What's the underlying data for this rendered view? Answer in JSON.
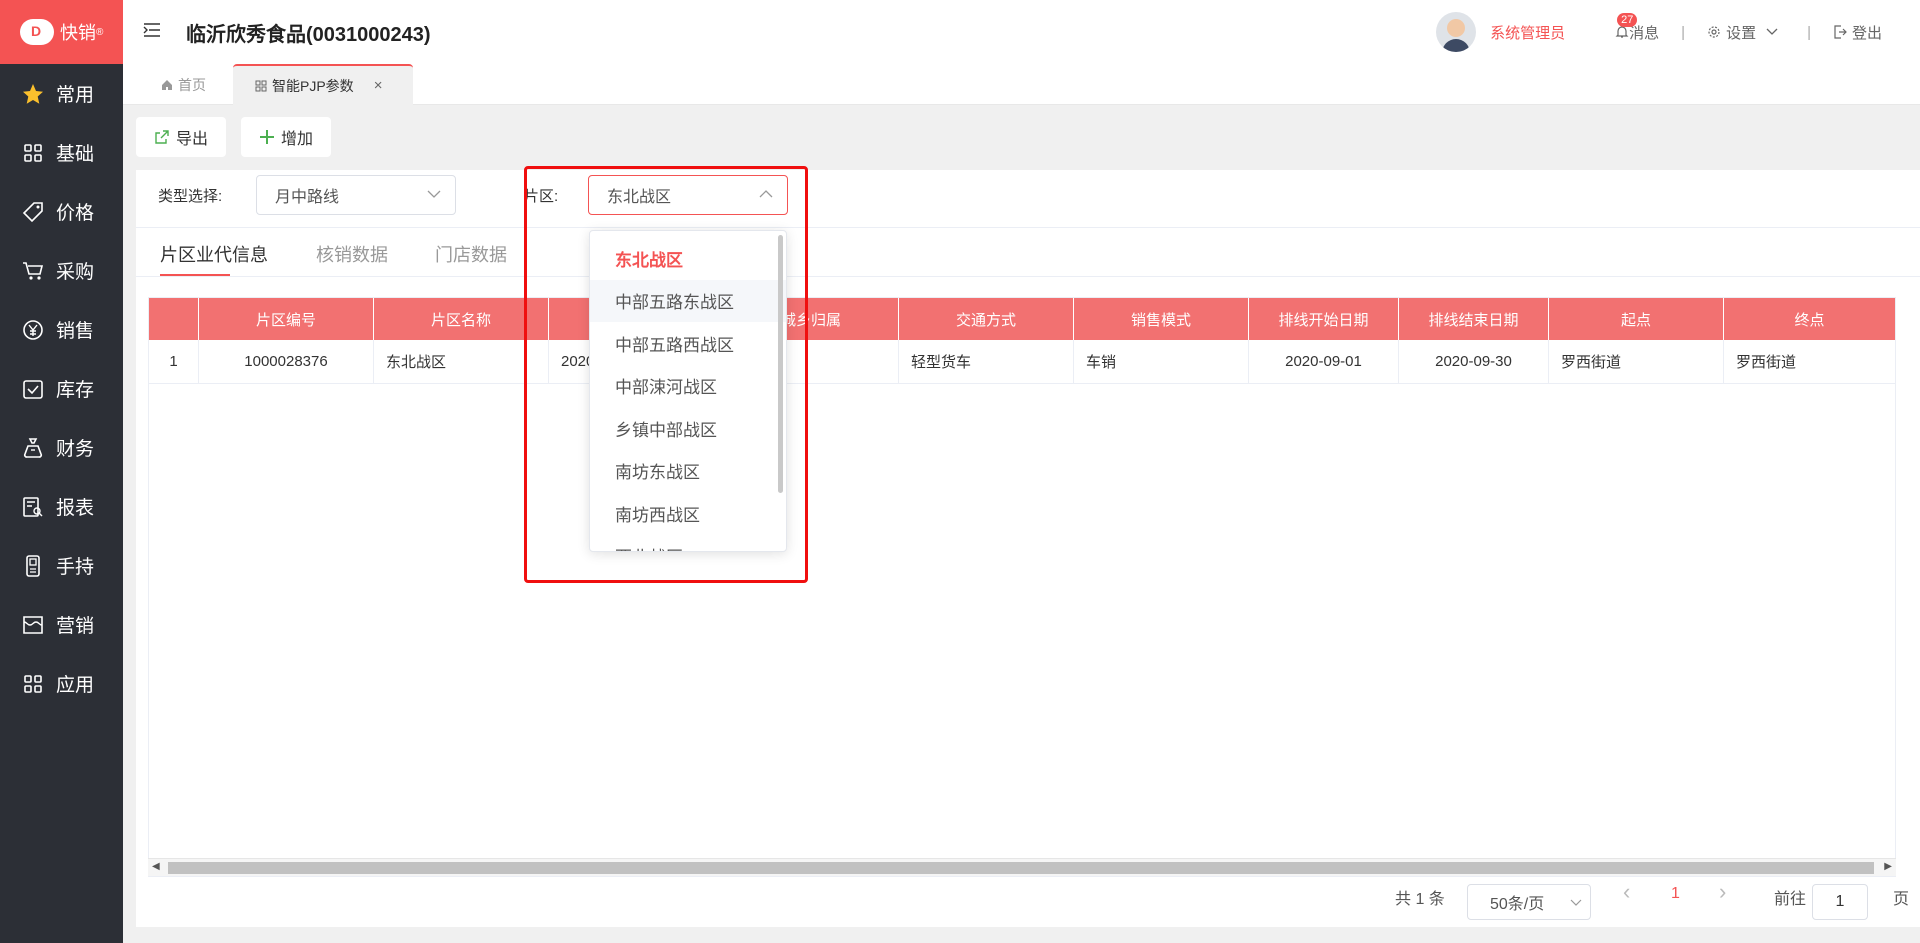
{
  "app": {
    "logo_text": "快销",
    "logo_mark": "®",
    "company": "临沂欣秀食品(0031000243)"
  },
  "sidebar": {
    "items": [
      {
        "label": "常用",
        "icon": "star-icon"
      },
      {
        "label": "基础",
        "icon": "grid-icon"
      },
      {
        "label": "价格",
        "icon": "price-tag-icon"
      },
      {
        "label": "采购",
        "icon": "cart-icon"
      },
      {
        "label": "销售",
        "icon": "yen-icon"
      },
      {
        "label": "库存",
        "icon": "inventory-check-icon"
      },
      {
        "label": "财务",
        "icon": "money-bag-icon"
      },
      {
        "label": "报表",
        "icon": "report-icon"
      },
      {
        "label": "手持",
        "icon": "handheld-icon"
      },
      {
        "label": "营销",
        "icon": "store-icon"
      },
      {
        "label": "应用",
        "icon": "apps-icon"
      }
    ]
  },
  "header": {
    "user": "系统管理员",
    "msg_count": "27",
    "msg_label": "消息",
    "settings": "设置",
    "logout": "登出",
    "sep": "|"
  },
  "tabs": {
    "home": "首页",
    "active": "智能PJP参数",
    "close": "×"
  },
  "toolbar": {
    "export": "导出",
    "add": "增加"
  },
  "filters": {
    "type_label": "类型选择:",
    "type_value": "月中路线",
    "area_label": "片区:",
    "area_value": "东北战区"
  },
  "subtabs": [
    "片区业代信息",
    "核销数据",
    "门店数据"
  ],
  "table": {
    "headers": [
      "",
      "片区编号",
      "片区名称",
      "",
      "城乡归属",
      "交通方式",
      "销售模式",
      "排线开始日期",
      "排线结束日期",
      "起点",
      "终点"
    ],
    "rows": [
      [
        "1",
        "1000028376",
        "东北战区",
        "2020",
        "",
        "轻型货车",
        "车销",
        "2020-09-01",
        "2020-09-30",
        "罗西街道",
        "罗西街道"
      ]
    ]
  },
  "pagination": {
    "total": "共 1 条",
    "page_size": "50条/页",
    "current": "1",
    "goto_label": "前往",
    "goto_value": "1",
    "page_suffix": "页",
    "prev": "‹",
    "next": "›"
  },
  "dropdown": {
    "options": [
      "东北战区",
      "中部五路东战区",
      "中部五路西战区",
      "中部涑河战区",
      "乡镇中部战区",
      "南坊东战区",
      "南坊西战区",
      "西北战区"
    ],
    "selected_index": 0,
    "hover_index": 1
  }
}
